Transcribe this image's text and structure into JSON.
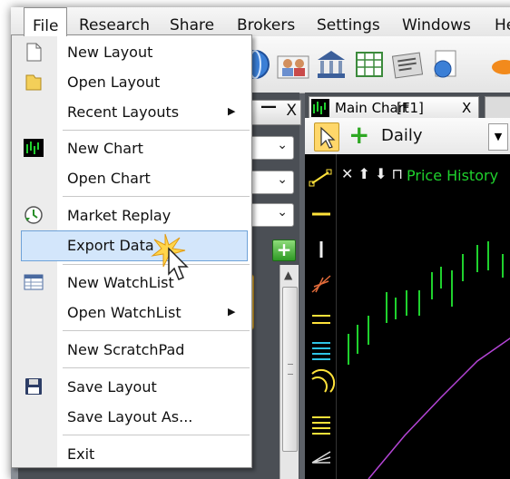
{
  "menubar": {
    "items": [
      "File",
      "Research",
      "Share",
      "Brokers",
      "Settings",
      "Windows",
      "He"
    ]
  },
  "file_menu": {
    "items": [
      {
        "label": "New Layout",
        "icon": "new-layout-icon",
        "submenu": false
      },
      {
        "label": "Open Layout",
        "icon": "folder-icon",
        "submenu": false
      },
      {
        "label": "Recent Layouts",
        "icon": "",
        "submenu": true
      },
      {
        "label": "New Chart",
        "icon": "chart-icon",
        "submenu": false
      },
      {
        "label": "Open Chart",
        "icon": "",
        "submenu": false
      },
      {
        "label": "Market Replay",
        "icon": "replay-icon",
        "submenu": false
      },
      {
        "label": "Export Data",
        "icon": "",
        "submenu": false,
        "highlighted": true
      },
      {
        "label": "New WatchList",
        "icon": "watchlist-icon",
        "submenu": false
      },
      {
        "label": "Open WatchList",
        "icon": "",
        "submenu": true
      },
      {
        "label": "New ScratchPad",
        "icon": "",
        "submenu": false
      },
      {
        "label": "Save Layout",
        "icon": "save-icon",
        "submenu": false
      },
      {
        "label": "Save Layout As...",
        "icon": "",
        "submenu": false
      },
      {
        "label": "Exit",
        "icon": "",
        "submenu": false
      }
    ],
    "submenu_arrow": "▶"
  },
  "left_panel": {
    "close_label": "X",
    "minimize_label": "—",
    "combo_arrow": "⌄",
    "add_label": "+"
  },
  "chart_window": {
    "tab_title": "Main Chart",
    "tab_shortcut": "[F1]",
    "tab_close": "X",
    "period": "Daily",
    "period_arrow": "▼",
    "series_label": "Price History",
    "header_symbols": "✕ ⬆ ⬇ ⊓"
  },
  "colors": {
    "menu_highlight": "#d3e6fb",
    "bars": "#1fd12d",
    "line": "#b445d6",
    "chart_bg": "#000000"
  }
}
